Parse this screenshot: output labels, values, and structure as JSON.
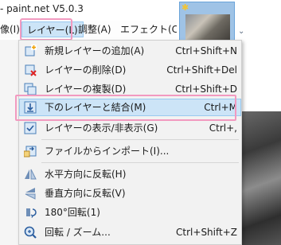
{
  "app": {
    "title": "- paint.net V5.0.3"
  },
  "menubar": {
    "items": [
      {
        "label": "像(I)"
      },
      {
        "label": "レイヤー(L)"
      },
      {
        "label": "調整(A)"
      },
      {
        "label": "エフェクト(C)"
      }
    ]
  },
  "layer_menu": {
    "items": [
      {
        "label": "新規レイヤーの追加(A)",
        "shortcut": "Ctrl+Shift+N",
        "icon": "add-layer-icon"
      },
      {
        "label": "レイヤーの削除(D)",
        "shortcut": "Ctrl+Shift+Del",
        "icon": "delete-layer-icon"
      },
      {
        "label": "レイヤーの複製(D)",
        "shortcut": "Ctrl+Shift+D",
        "icon": "duplicate-layer-icon"
      },
      {
        "label": "下のレイヤーと結合(M)",
        "shortcut": "Ctrl+M",
        "icon": "merge-down-icon"
      },
      {
        "label": "レイヤーの表示/非表示(G)",
        "shortcut": "Ctrl+,",
        "icon": "toggle-visibility-icon"
      },
      {
        "label": "ファイルからインポート(I)...",
        "shortcut": "",
        "icon": "import-file-icon"
      },
      {
        "label": "水平方向に反転(H)",
        "shortcut": "",
        "icon": "flip-horizontal-icon"
      },
      {
        "label": "垂直方向に反転(V)",
        "shortcut": "",
        "icon": "flip-vertical-icon"
      },
      {
        "label": "180°回転(1)",
        "shortcut": "",
        "icon": "rotate-180-icon"
      },
      {
        "label": "回転 / ズーム...",
        "shortcut": "Ctrl+Shift+Z",
        "icon": "rotate-zoom-icon"
      }
    ]
  },
  "colors": {
    "accent": "#cce4f7",
    "highlight_border": "#f29ac0"
  }
}
